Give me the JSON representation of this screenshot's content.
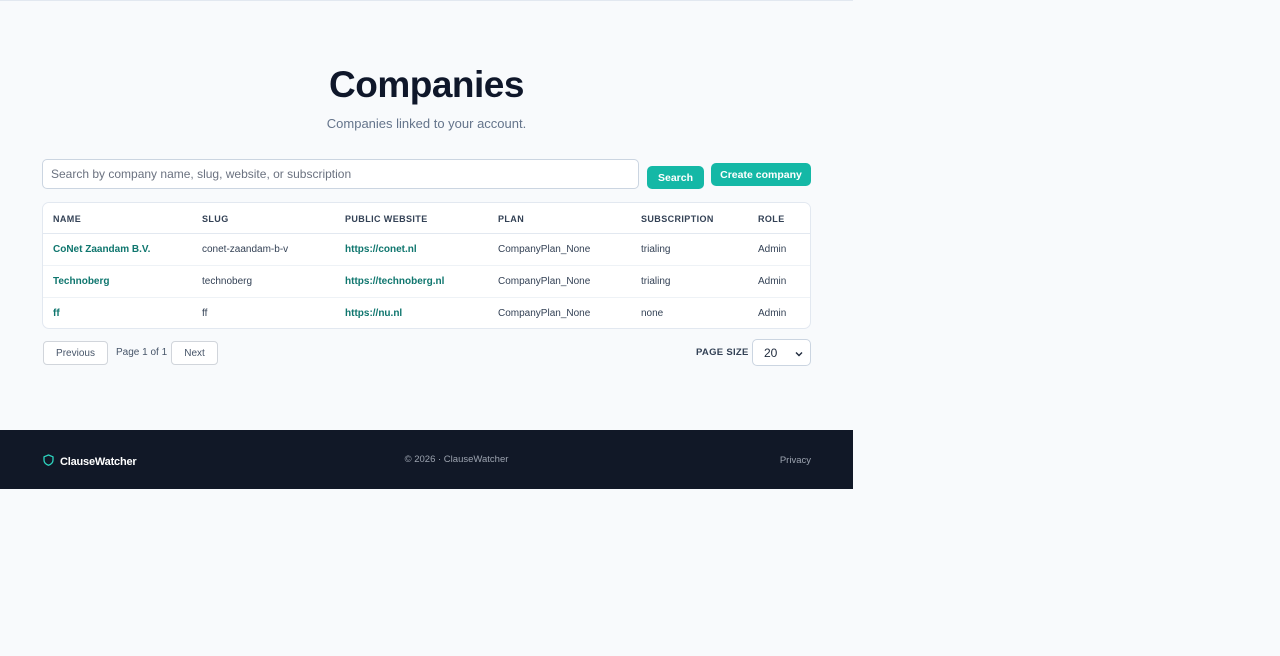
{
  "header": {
    "title": "Companies",
    "subtitle": "Companies linked to your account."
  },
  "search": {
    "placeholder": "Search by company name, slug, website, or subscription",
    "value": "",
    "button_label": "Search"
  },
  "actions": {
    "create_label": "Create company"
  },
  "table": {
    "columns": [
      "NAME",
      "SLUG",
      "PUBLIC WEBSITE",
      "PLAN",
      "SUBSCRIPTION",
      "ROLE"
    ],
    "rows": [
      {
        "name": "CoNet Zaandam B.V.",
        "slug": "conet-zaandam-b-v",
        "website": "https://conet.nl",
        "plan": "CompanyPlan_None",
        "subscription": "trialing",
        "role": "Admin"
      },
      {
        "name": "Technoberg",
        "slug": "technoberg",
        "website": "https://technoberg.nl",
        "plan": "CompanyPlan_None",
        "subscription": "trialing",
        "role": "Admin"
      },
      {
        "name": "ff",
        "slug": "ff",
        "website": "https://nu.nl",
        "plan": "CompanyPlan_None",
        "subscription": "none",
        "role": "Admin"
      }
    ]
  },
  "pagination": {
    "previous_label": "Previous",
    "page_info": "Page 1 of 1",
    "next_label": "Next",
    "page_size_label": "PAGE SIZE",
    "page_size_value": "20"
  },
  "footer": {
    "brand": "ClauseWatcher",
    "brand_icon": "shield-icon",
    "copyright": "© 2026 · ClauseWatcher",
    "privacy_label": "Privacy"
  },
  "colors": {
    "accent": "#14b8a6",
    "link": "#0f766e",
    "footer_bg": "#111827",
    "page_bg": "#f8fafc"
  }
}
